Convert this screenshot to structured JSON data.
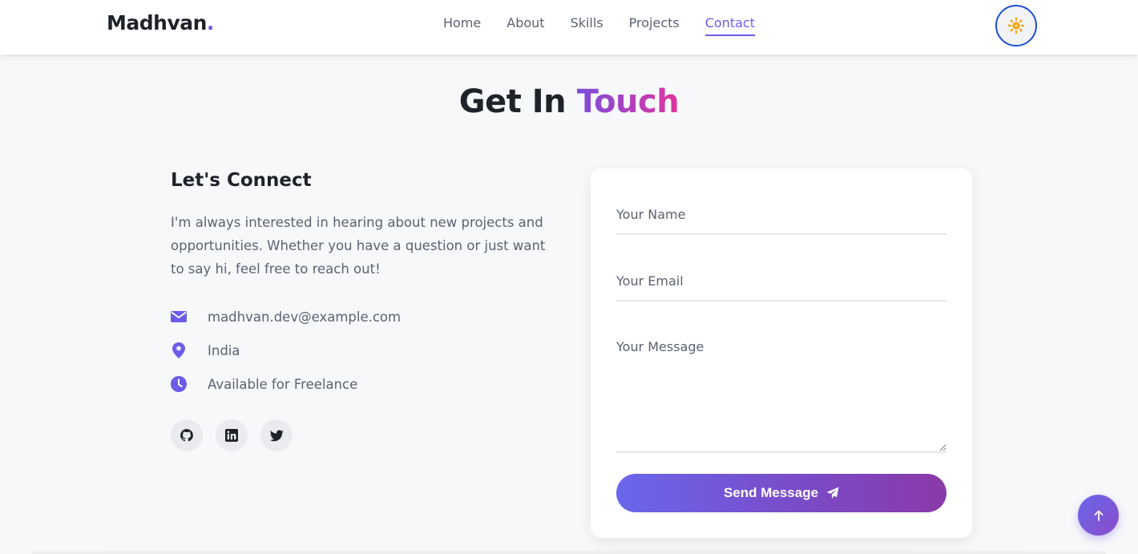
{
  "header": {
    "logo_text": "Madhvan",
    "logo_dot": ".",
    "nav": [
      {
        "label": "Home",
        "active": false
      },
      {
        "label": "About",
        "active": false
      },
      {
        "label": "Skills",
        "active": false
      },
      {
        "label": "Projects",
        "active": false
      },
      {
        "label": "Contact",
        "active": true
      }
    ],
    "theme_toggle_icon": "sun-icon"
  },
  "section": {
    "title_main": "Get In",
    "title_accent": "Touch"
  },
  "connect": {
    "title": "Let's Connect",
    "text": "I'm always interested in hearing about new projects and opportunities. Whether you have a question or just want to say hi, feel free to reach out!",
    "info": [
      {
        "icon": "envelope-icon",
        "text": "madhvan.dev@example.com"
      },
      {
        "icon": "location-pin-icon",
        "text": "India"
      },
      {
        "icon": "clock-icon",
        "text": "Available for Freelance"
      }
    ],
    "social": [
      {
        "icon": "github-icon"
      },
      {
        "icon": "linkedin-icon"
      },
      {
        "icon": "twitter-icon"
      }
    ]
  },
  "form": {
    "name_placeholder": "Your Name",
    "email_placeholder": "Your Email",
    "message_placeholder": "Your Message",
    "name_value": "",
    "email_value": "",
    "message_value": "",
    "submit_label": "Send Message",
    "submit_icon": "paper-plane-icon"
  },
  "scroll_top_icon": "arrow-up-icon",
  "colors": {
    "accent": "#6c5ce7",
    "gradient_start": "#7c4ddc",
    "gradient_end": "#e0359e",
    "toggle_border": "#1e4fd1",
    "sun": "#f5a10a"
  }
}
